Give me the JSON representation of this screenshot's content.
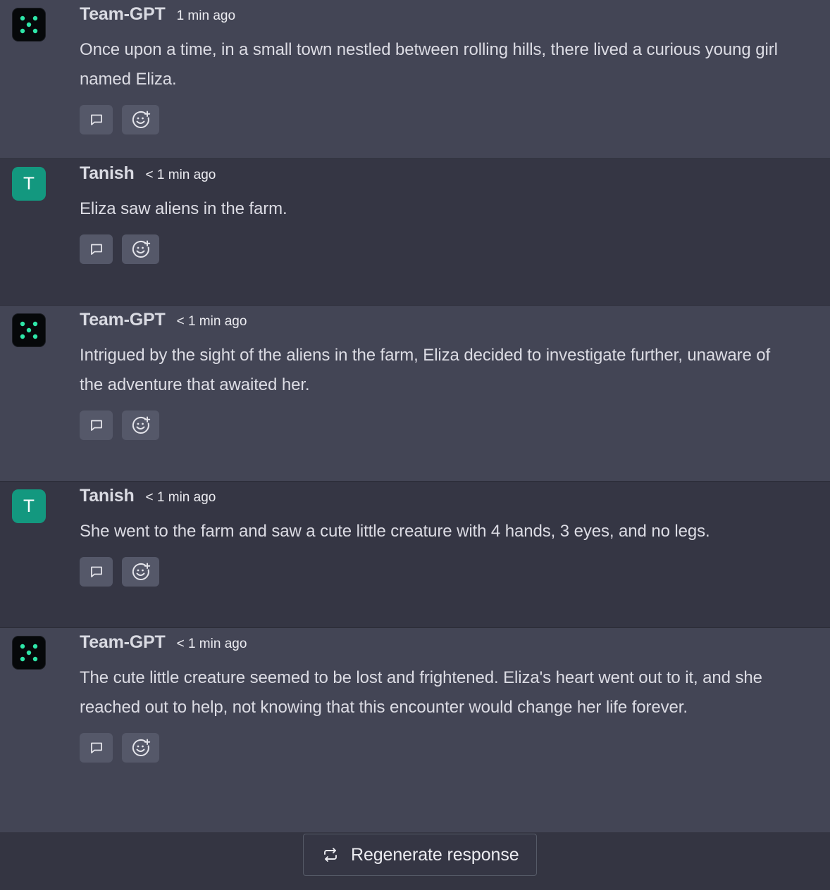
{
  "messages": [
    {
      "role": "bot",
      "author": "Team-GPT",
      "time": "1 min ago",
      "text": "Once upon a time, in a small town nestled between rolling hills, there lived a curious young girl named Eliza."
    },
    {
      "role": "user",
      "author": "Tanish",
      "avatar_letter": "T",
      "time": "< 1 min ago",
      "text": "Eliza saw aliens in the farm."
    },
    {
      "role": "bot",
      "author": "Team-GPT",
      "time": "< 1 min ago",
      "text": "Intrigued by the sight of the aliens in the farm, Eliza decided to investigate further, unaware of the adventure that awaited her."
    },
    {
      "role": "user",
      "author": "Tanish",
      "avatar_letter": "T",
      "time": "< 1 min ago",
      "text": "She went to the farm and saw a cute little creature with 4 hands, 3 eyes, and no legs."
    },
    {
      "role": "bot",
      "author": "Team-GPT",
      "time": "< 1 min ago",
      "text": "The cute little creature seemed to be lost and frightened. Eliza's heart went out to it, and she reached out to help, not knowing that this encounter would change her life forever."
    }
  ],
  "message_actions": {
    "comment_icon": "comment-icon",
    "react_icon": "add-reaction-icon"
  },
  "footer": {
    "regenerate_label": "Regenerate response",
    "regenerate_icon": "repeat-icon"
  },
  "colors": {
    "bot_row_bg": "#434555",
    "user_row_bg": "#353644",
    "bot_logo_dots": "#2ee6a8",
    "user_avatar_bg": "#13987f"
  }
}
